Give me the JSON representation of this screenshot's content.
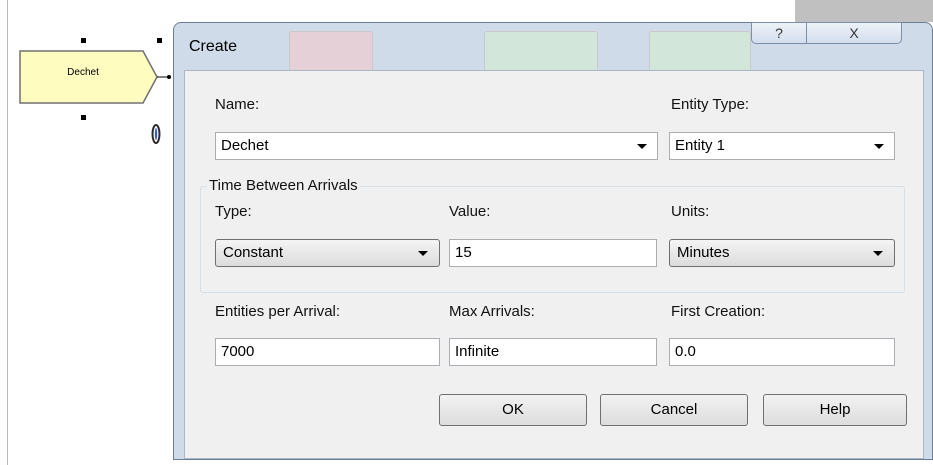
{
  "canvas": {
    "module_name": "Dechet"
  },
  "dialog": {
    "title": "Create",
    "help_glyph": "?",
    "close_glyph": "X",
    "name": {
      "label": "Name:",
      "value": "Dechet"
    },
    "entity_type": {
      "label": "Entity Type:",
      "value": "Entity 1"
    },
    "time_between_arrivals": {
      "group_label": "Time Between Arrivals",
      "type": {
        "label": "Type:",
        "value": "Constant"
      },
      "value": {
        "label": "Value:",
        "value": "15"
      },
      "units": {
        "label": "Units:",
        "value": "Minutes"
      }
    },
    "entities_per_arrival": {
      "label": "Entities per Arrival:",
      "value": "7000"
    },
    "max_arrivals": {
      "label": "Max Arrivals:",
      "value": "Infinite"
    },
    "first_creation": {
      "label": "First Creation:",
      "value": "0.0"
    },
    "buttons": {
      "ok": "OK",
      "cancel": "Cancel",
      "help": "Help"
    }
  },
  "colors": {
    "dialog_frame": "#cfdbe8",
    "client_bg": "#f0f0f0",
    "module_fill": "#fffcc0"
  }
}
